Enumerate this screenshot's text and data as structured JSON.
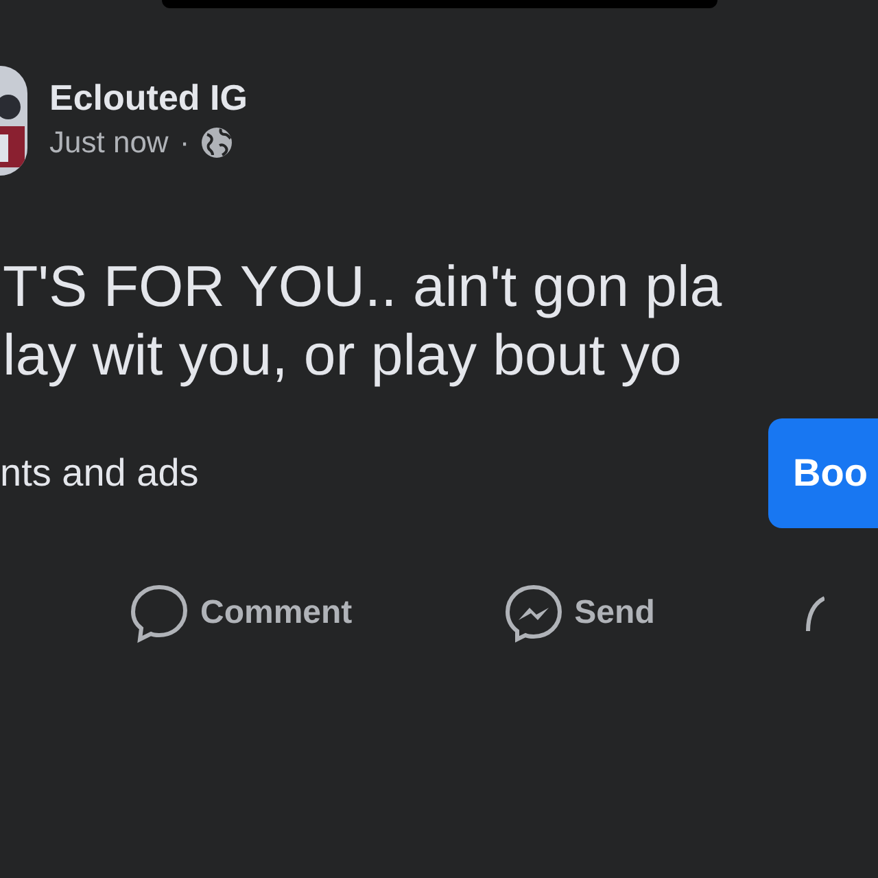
{
  "post": {
    "author": "Eclouted IG",
    "time": "Just now",
    "separator": "·",
    "text_lines": [
      "T'S FOR YOU.. ain't gon pla",
      "lay wit you, or play bout yo"
    ],
    "link_text": "nts and ads",
    "button": "Boo"
  },
  "actions": [
    {
      "kind": "comment",
      "label": "Comment"
    },
    {
      "kind": "send",
      "label": "Send"
    },
    {
      "kind": "share"
    }
  ]
}
